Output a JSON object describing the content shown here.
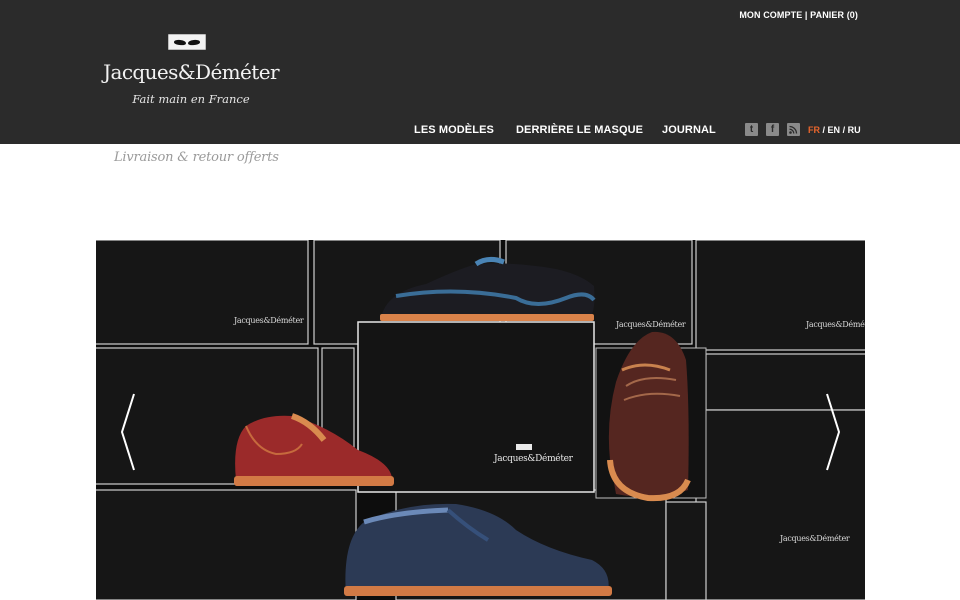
{
  "header": {
    "account_label": "MON COMPTE",
    "separator": "|",
    "cart_label": "PANIER (0)",
    "brand": "Jacques&Déméter",
    "tagline": "Fait main en France",
    "nav": [
      "LES MODÈLES",
      "DERRIÈRE LE MASQUE",
      "JOURNAL"
    ],
    "social_icons": [
      "twitter-icon",
      "facebook-icon",
      "rss-icon"
    ],
    "languages": {
      "fr": "FR",
      "en": "EN",
      "ru": "RU",
      "sep": "/",
      "active": "FR"
    }
  },
  "promo": {
    "shipping": "Livraison & retour offerts"
  },
  "hero": {
    "prev_icon": "chevron-left-icon",
    "next_icon": "chevron-right-icon",
    "box_brand": "Jacques&Déméter"
  },
  "colors": {
    "header_bg": "#2b2b2b",
    "accent": "#e8652c",
    "shipping_text": "#9a9a9a"
  }
}
